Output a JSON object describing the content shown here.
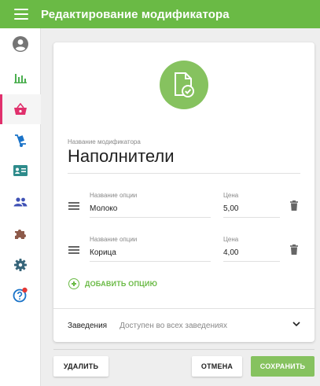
{
  "header": {
    "title": "Редактирование модификатора"
  },
  "sidebar": {
    "items": [
      {
        "name": "profile",
        "icon": "user-circle-icon"
      },
      {
        "name": "reports",
        "icon": "bar-chart-icon"
      },
      {
        "name": "products",
        "icon": "basket-icon",
        "active": true
      },
      {
        "name": "delivery",
        "icon": "hand-truck-icon"
      },
      {
        "name": "cards",
        "icon": "id-card-icon"
      },
      {
        "name": "clients",
        "icon": "people-icon"
      },
      {
        "name": "modules",
        "icon": "puzzle-icon"
      },
      {
        "name": "settings",
        "icon": "gear-icon"
      },
      {
        "name": "help",
        "icon": "help-circle-icon",
        "badge": true
      }
    ]
  },
  "form": {
    "name_label": "Название модификатора",
    "name_value": "Наполнители",
    "options": [
      {
        "name_label": "Название опции",
        "name": "Молоко",
        "price_label": "Цена",
        "price": "5,00"
      },
      {
        "name_label": "Название опции",
        "name": "Корица",
        "price_label": "Цена",
        "price": "4,00"
      }
    ],
    "add_option_label": "ДОБАВИТЬ ОПЦИЮ",
    "venues_label": "Заведения",
    "venues_value": "Доступен во всех заведениях"
  },
  "actions": {
    "delete_label": "УДАЛИТЬ",
    "cancel_label": "ОТМЕНА",
    "save_label": "СОХРАНИТЬ"
  },
  "colors": {
    "accent": "#6aba45",
    "accent_light": "#86c25f",
    "active_marker": "#e0306c",
    "icon_blue": "#1a73c8",
    "icon_teal": "#2e8b8b"
  }
}
